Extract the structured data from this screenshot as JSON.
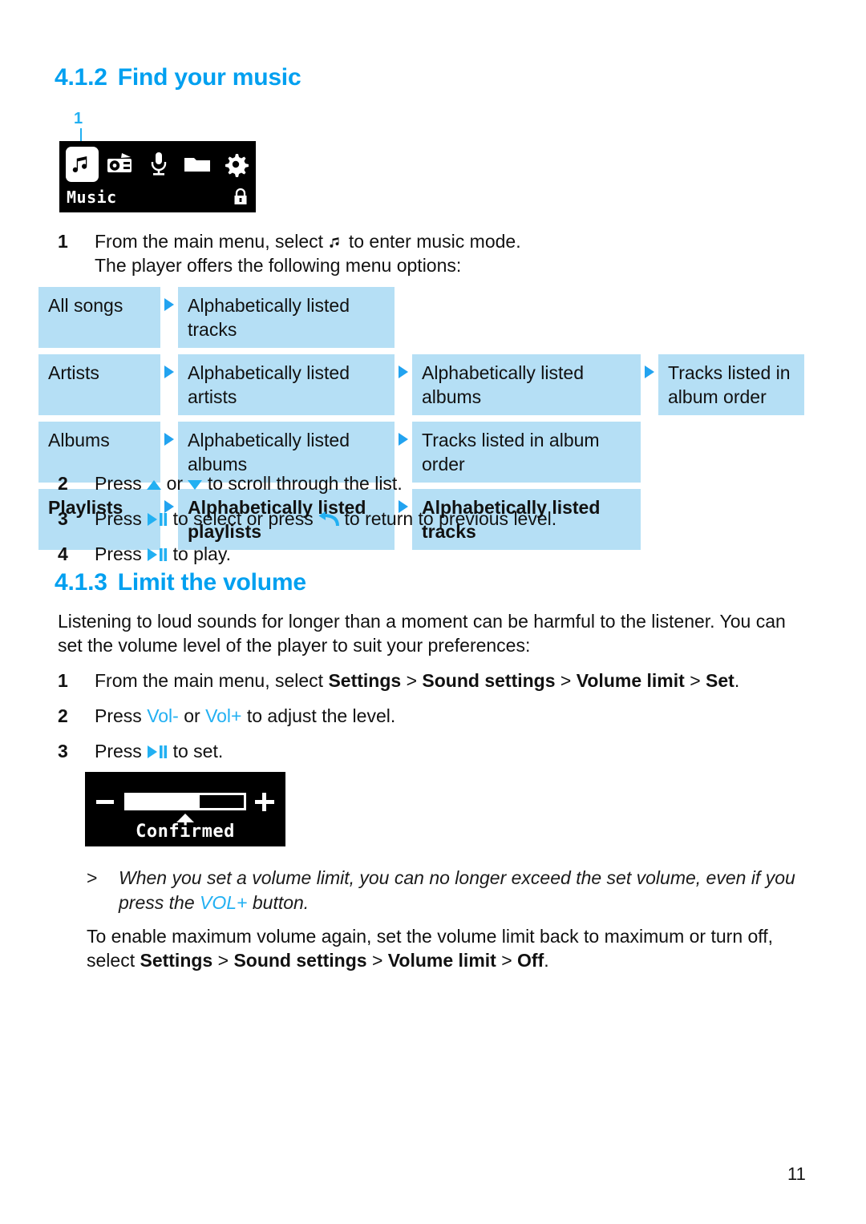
{
  "sections": {
    "find_music": {
      "number": "4.1.2",
      "title": "Find your music",
      "callout_label": "1",
      "device_screen": {
        "label": "Music",
        "icons": [
          "music-note-icon",
          "radio-icon",
          "microphone-icon",
          "folder-icon",
          "gear-icon"
        ],
        "selected_icon": "music-note-icon",
        "status_icon": "lock-icon"
      },
      "step1": {
        "number": "1",
        "text_before": "From the main menu, select",
        "text_after": "to enter music mode.",
        "line2": "The player offers the following menu options:"
      },
      "step2": {
        "number": "2",
        "text_before": "Press",
        "text_mid": "or",
        "text_after": "to scroll through the list."
      },
      "step3": {
        "number": "3",
        "text_before": "Press",
        "text_mid": "to select or press",
        "text_after": "to return to previous level."
      },
      "step4": {
        "number": "4",
        "text_before": "Press",
        "text_after": "to play."
      },
      "menu_table": {
        "rows": [
          {
            "bold": false,
            "cells": [
              "All songs",
              "Alphabetically listed tracks"
            ]
          },
          {
            "bold": false,
            "cells": [
              "Artists",
              "Alphabetically listed artists",
              "Alphabetically listed albums",
              "Tracks listed in album order"
            ]
          },
          {
            "bold": false,
            "cells": [
              "Albums",
              "Alphabetically listed albums",
              "Tracks listed in album order"
            ]
          },
          {
            "bold": true,
            "cells": [
              "Playlists",
              "Alphabetically listed playlists",
              "Alphabetically listed tracks"
            ]
          }
        ]
      }
    },
    "limit_volume": {
      "number": "4.1.3",
      "title": "Limit the volume",
      "intro_line1": "Listening to loud sounds for longer than a moment can be harmful to the listener. You can",
      "intro_line2": "set the volume level of the player to suit your preferences:",
      "step1": {
        "number": "1",
        "lead": "From the main menu, select",
        "b1": "Settings",
        "sep1": ">",
        "b2": "Sound settings",
        "sep2": ">",
        "b3": "Volume limit",
        "sep3": ">",
        "b4": "Set",
        "end": "."
      },
      "step2": {
        "number": "2",
        "text_before": "Press",
        "vol_down": "Vol-",
        "text_mid": "or",
        "vol_up": "Vol+",
        "text_after": "to adjust the level."
      },
      "step3": {
        "number": "3",
        "text_before": "Press",
        "text_after": "to set."
      },
      "volume_screen": {
        "label": "Confirmed",
        "minus_icon": "minus-icon",
        "plus_icon": "plus-icon",
        "fill_percent": 62
      },
      "note": {
        "marker": ">",
        "line1": "When you set a volume limit, you can no longer exceed the set volume, even if you press the",
        "highlight": "VOL+",
        "line2_tail": "button."
      },
      "closing": {
        "line1": "To enable maximum volume again, set the volume limit back to maximum or turn off,",
        "lead2": "select",
        "b1": "Settings",
        "sep1": ">",
        "b2": "Sound settings",
        "sep2": ">",
        "b3": "Volume limit",
        "sep3": ">",
        "b4": "Off",
        "end": "."
      }
    }
  },
  "footer": {
    "page_number": "11"
  },
  "colors": {
    "accent_blue": "#00a0f0",
    "icon_blue": "#22b0f2",
    "cell_blue": "#b5dff5",
    "device_black": "#000000"
  }
}
